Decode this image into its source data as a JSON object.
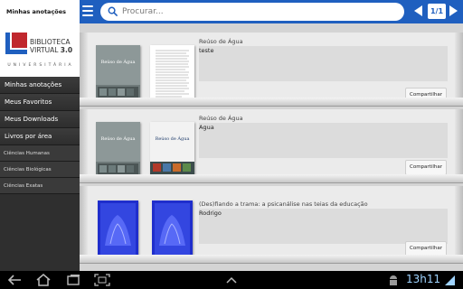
{
  "header": {
    "title": "Minhas anotações",
    "search_placeholder": "Procurar...",
    "pager": "1/1"
  },
  "logo": {
    "line1": "BIBLIOTECA",
    "line2": "VIRTUAL",
    "version": "3.0",
    "subtitle": "UNIVERSITÁRIA"
  },
  "sidebar": {
    "items": [
      {
        "label": "Minhas anotações"
      },
      {
        "label": "Meus Favoritos"
      },
      {
        "label": "Meus Downloads"
      },
      {
        "label": "Livros por área"
      }
    ],
    "subitems": [
      {
        "label": "Ciências Humanas"
      },
      {
        "label": "Ciências Biológicas"
      },
      {
        "label": "Ciências Exatas"
      }
    ]
  },
  "notes": [
    {
      "book_title": "Reúso de Água",
      "note": "teste",
      "share_label": "Compartilhar",
      "cover_text": "Reúso de Água"
    },
    {
      "book_title": "Reúso de Água",
      "note": "Agua",
      "share_label": "Compartilhar",
      "cover_text": "Reúso de Água"
    },
    {
      "book_title": "(Des)fiando a trama: a psicanálise nas teias da educação",
      "note": "Rodrigo",
      "share_label": "Compartilhar",
      "cover_text": ""
    }
  ],
  "status_bar": {
    "time": "13h11"
  },
  "icons": [
    "menu-icon",
    "search-icon",
    "prev-page-icon",
    "next-page-icon",
    "back-icon",
    "home-icon",
    "recent-apps-icon",
    "up-arrow-icon",
    "android-icon",
    "signal-icon"
  ],
  "colors": {
    "accent": "#1f5fbf",
    "sidebar_bg": "#2f2f2f",
    "clock": "#9fd3ff",
    "logo_red": "#c0272d",
    "logo_blue": "#1f5fbf"
  }
}
